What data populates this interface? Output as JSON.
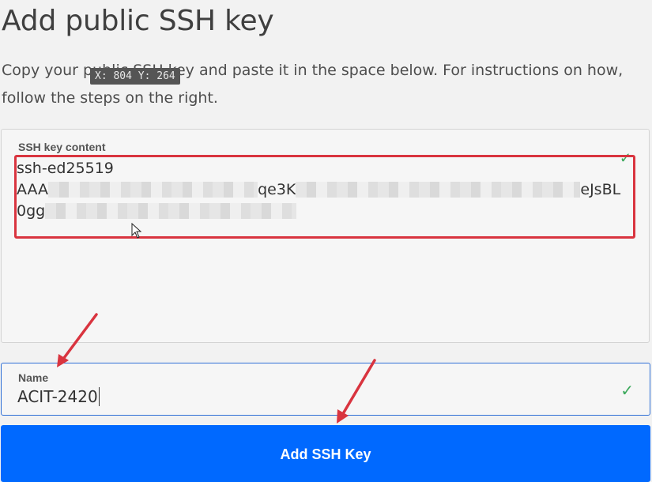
{
  "page": {
    "title": "Add public SSH key",
    "description": "Copy your public SSH key and paste it in the space below. For instructions on how, follow the steps on the right."
  },
  "tooltip": {
    "coords": "X: 804 Y: 264"
  },
  "key_field": {
    "label": "SSH key content",
    "line1": "ssh-ed25519",
    "line2_start": "AAA",
    "line2_mid": "qe3K",
    "line2_end": "eJsBL",
    "line3_start": "0gg",
    "valid_icon": "check-icon"
  },
  "name_field": {
    "label": "Name",
    "value": "ACIT-2420",
    "valid_icon": "check-icon"
  },
  "button": {
    "label": "Add SSH Key"
  },
  "colors": {
    "primary": "#0069ff",
    "annotation": "#d9343f",
    "valid": "#3aa85a"
  }
}
